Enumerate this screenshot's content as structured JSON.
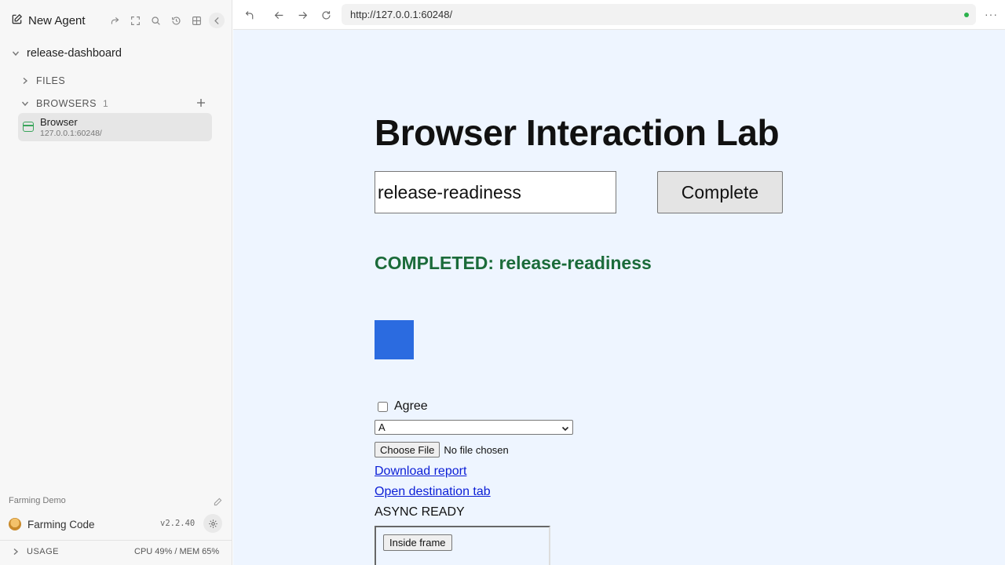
{
  "sidebar": {
    "new_agent_label": "New Agent",
    "project_name": "release-dashboard",
    "files_label": "FILES",
    "browsers_label": "BROWSERS",
    "browsers_count": "1",
    "browser_item": {
      "name": "Browser",
      "url": "127.0.0.1:60248/"
    },
    "workspace_label": "Farming Demo",
    "account_name": "Farming Code",
    "version": "v2.2.40",
    "usage_label": "USAGE",
    "usage_stats": "CPU 49% / MEM 65%"
  },
  "browser": {
    "url": "http://127.0.0.1:60248/",
    "status_color": "#2bb24c",
    "more_label": "···"
  },
  "page": {
    "title": "Browser Interaction Lab",
    "task_input_value": "release-readiness",
    "complete_button": "Complete",
    "status_message": "COMPLETED: release-readiness",
    "status_color": "#1b6b3a",
    "box_color": "#2b6be0",
    "agree_label": "Agree",
    "select_value": "A",
    "file_button": "Choose File",
    "file_status": "No file chosen",
    "download_link": "Download report",
    "open_tab_link": "Open destination tab",
    "async_status": "ASYNC READY",
    "frame_button": "Inside frame"
  }
}
